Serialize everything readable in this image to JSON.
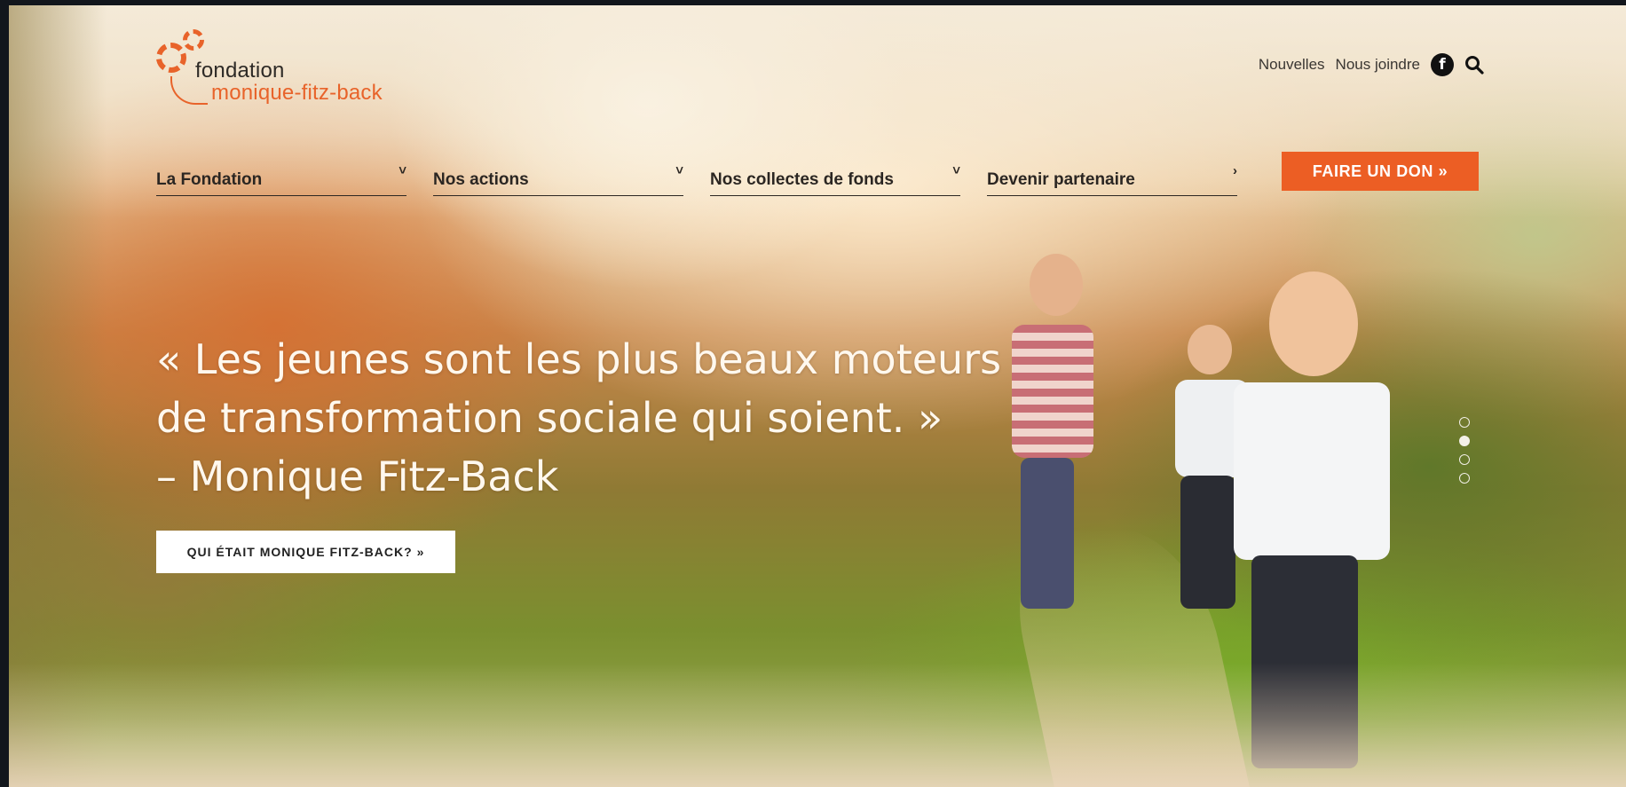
{
  "logo": {
    "line1": "fondation",
    "line2": "monique-fitz-back",
    "icon": "gears-flower-icon"
  },
  "utility_nav": {
    "news": "Nouvelles",
    "contact": "Nous joindre",
    "facebook_icon": "facebook-icon",
    "search_icon": "search-icon"
  },
  "main_nav": [
    {
      "label": "La Fondation",
      "indicator": "˅"
    },
    {
      "label": "Nos actions",
      "indicator": "˅"
    },
    {
      "label": "Nos collectes de fonds",
      "indicator": "˅"
    },
    {
      "label": "Devenir partenaire",
      "indicator": "›"
    }
  ],
  "donate_button": "FAIRE UN DON »",
  "hero": {
    "quote_line1": "« Les jeunes sont les plus beaux moteurs",
    "quote_line2": "de transformation sociale qui soient. »",
    "quote_line3": "– Monique Fitz-Back",
    "cta_label": "QUI ÉTAIT MONIQUE FITZ-BACK? »"
  },
  "slider": {
    "total_slides": 4,
    "active_slide": 2
  },
  "colors": {
    "accent": "#ec5e24",
    "nav_text": "#2b2622",
    "hero_text": "#fff8ee"
  }
}
